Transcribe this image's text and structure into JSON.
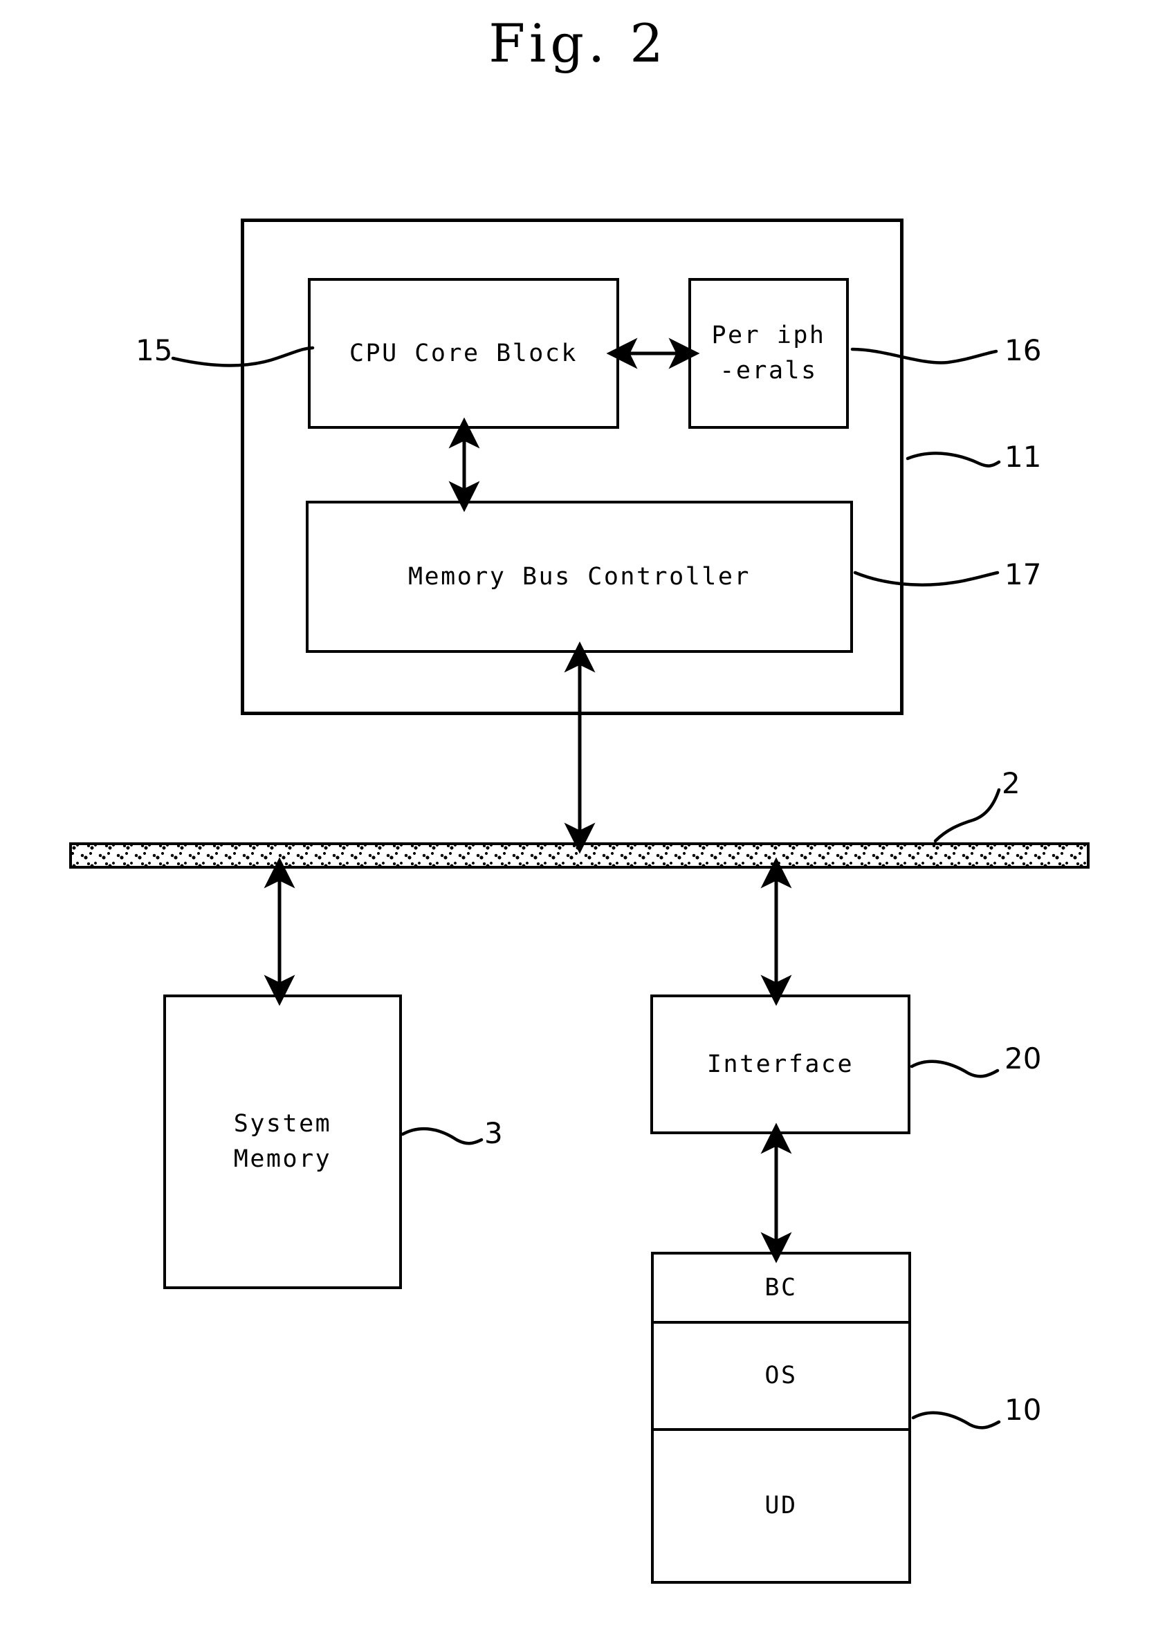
{
  "figure": {
    "title": "Fig. 2",
    "type": "block-diagram"
  },
  "blocks": {
    "soc": {
      "name": "system-on-chip-container",
      "ref": "11"
    },
    "cpu_core_block": {
      "label": "CPU Core Block",
      "ref": "15"
    },
    "peripherals": {
      "label": "Per iph\n-erals",
      "ref": "16"
    },
    "memory_bus_controller": {
      "label": "Memory Bus Controller",
      "ref": "17"
    },
    "system_bus": {
      "label": "",
      "ref": "2"
    },
    "system_memory": {
      "label": "System\nMemory",
      "ref": "3"
    },
    "interface": {
      "label": "Interface",
      "ref": "20"
    },
    "storage": {
      "ref": "10",
      "cells": [
        {
          "label": "BC"
        },
        {
          "label": "OS"
        },
        {
          "label": "UD"
        }
      ]
    }
  },
  "reference_numerals": {
    "r15": "15",
    "r16": "16",
    "r11": "11",
    "r17": "17",
    "r2": "2",
    "r3": "3",
    "r20": "20",
    "r10": "10"
  },
  "colors": {
    "ink": "#000000",
    "paper": "#ffffff"
  }
}
